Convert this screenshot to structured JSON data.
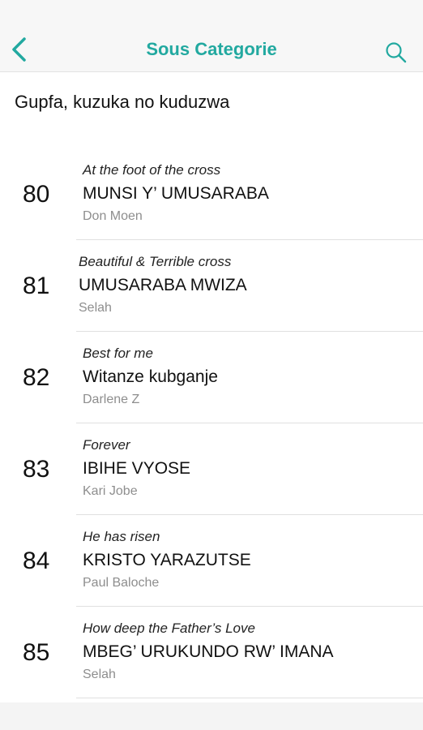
{
  "navbar": {
    "back_icon": "chevron-left-icon",
    "title": "Sous Categorie",
    "search_icon": "search-icon",
    "accent_color": "#22a9a0"
  },
  "section": {
    "title": "Gupfa, kuzuka no kuduzwa"
  },
  "songs": [
    {
      "number": "80",
      "original": "At the foot of the cross",
      "title": "MUNSI Y’ UMUSARABA",
      "artist": "Don Moen"
    },
    {
      "number": "81",
      "original": "Beautiful & Terrible cross",
      "title": "UMUSARABA MWIZA",
      "artist": "Selah"
    },
    {
      "number": "82",
      "original": "Best for me",
      "title": "Witanze kubganje",
      "artist": "Darlene Z"
    },
    {
      "number": "83",
      "original": "Forever",
      "title": "IBIHE VYOSE",
      "artist": "Kari Jobe"
    },
    {
      "number": "84",
      "original": "He has risen",
      "title": "KRISTO YARAZUTSE",
      "artist": "Paul Baloche"
    },
    {
      "number": "85",
      "original": "How deep the Father’s Love",
      "title": "MBEG’ URUKUNDO RW’ IMANA",
      "artist": "Selah"
    }
  ]
}
